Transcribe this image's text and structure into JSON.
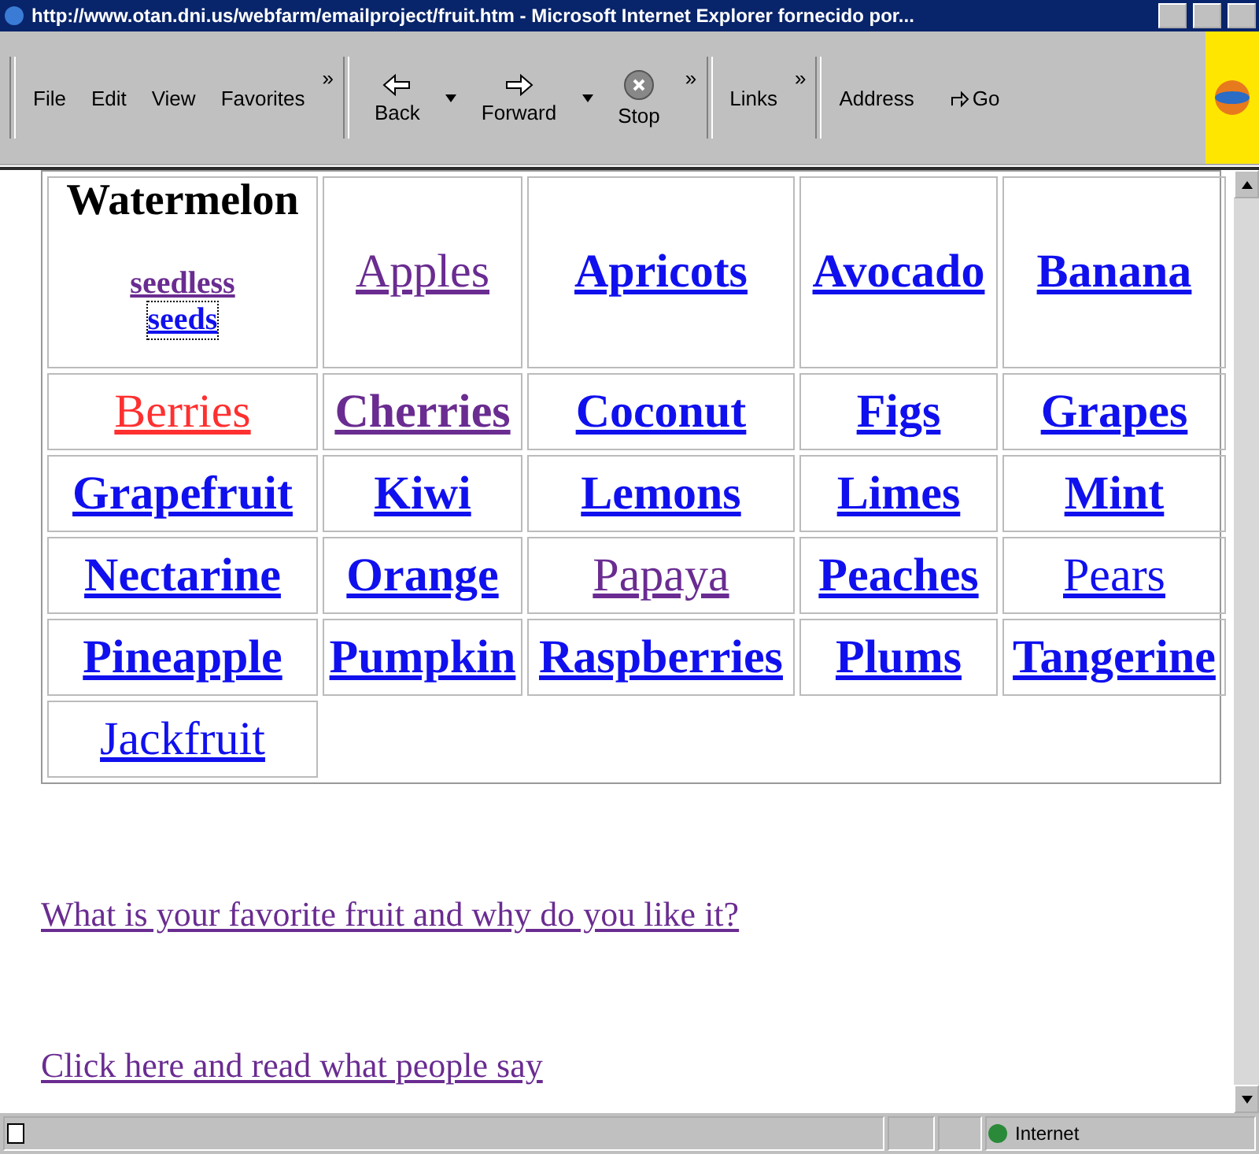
{
  "window": {
    "title": "http://www.otan.dni.us/webfarm/emailproject/fruit.htm - Microsoft Internet Explorer fornecido por..."
  },
  "menu": [
    "File",
    "Edit",
    "View",
    "Favorites"
  ],
  "toolbar": {
    "chevrons": [
      "»",
      "»",
      "»"
    ],
    "buttons": [
      {
        "kind": "back",
        "label": "Back"
      },
      {
        "kind": "forward",
        "label": "Forward"
      },
      {
        "kind": "stop",
        "label": "Stop"
      }
    ],
    "links": "Links",
    "address": "Address",
    "go": "Go"
  },
  "watermelon": {
    "title": "Watermelon",
    "links": [
      {
        "text": "seedless",
        "visited": true,
        "focused": false
      },
      {
        "text": "seeds",
        "visited": false,
        "focused": true
      }
    ]
  },
  "fruits": [
    {
      "text": "Apples",
      "visited": true,
      "active": false,
      "bold": false
    },
    {
      "text": "Apricots",
      "visited": false,
      "active": false,
      "bold": true
    },
    {
      "text": "Avocado",
      "visited": false,
      "active": false,
      "bold": true
    },
    {
      "text": "Banana",
      "visited": false,
      "active": false,
      "bold": true
    },
    {
      "text": "Berries",
      "visited": false,
      "active": true,
      "bold": false
    },
    {
      "text": "Cherries",
      "visited": true,
      "active": false,
      "bold": true
    },
    {
      "text": "Coconut",
      "visited": false,
      "active": false,
      "bold": true
    },
    {
      "text": "Figs",
      "visited": false,
      "active": false,
      "bold": true
    },
    {
      "text": "Grapes",
      "visited": false,
      "active": false,
      "bold": true
    },
    {
      "text": "Grapefruit",
      "visited": false,
      "active": false,
      "bold": true
    },
    {
      "text": "Kiwi",
      "visited": false,
      "active": false,
      "bold": true
    },
    {
      "text": "Lemons",
      "visited": false,
      "active": false,
      "bold": true
    },
    {
      "text": "Limes",
      "visited": false,
      "active": false,
      "bold": true
    },
    {
      "text": "Mint",
      "visited": false,
      "active": false,
      "bold": true
    },
    {
      "text": "Nectarine",
      "visited": false,
      "active": false,
      "bold": true
    },
    {
      "text": "Orange",
      "visited": false,
      "active": false,
      "bold": true
    },
    {
      "text": "Papaya",
      "visited": true,
      "active": false,
      "bold": false
    },
    {
      "text": "Peaches",
      "visited": false,
      "active": false,
      "bold": true
    },
    {
      "text": "Pears",
      "visited": false,
      "active": false,
      "bold": false
    },
    {
      "text": "Pineapple",
      "visited": false,
      "active": false,
      "bold": true
    },
    {
      "text": "Pumpkin",
      "visited": false,
      "active": false,
      "bold": true
    },
    {
      "text": "Raspberries",
      "visited": false,
      "active": false,
      "bold": true
    },
    {
      "text": "Plums",
      "visited": false,
      "active": false,
      "bold": true
    },
    {
      "text": "Tangerine",
      "visited": false,
      "active": false,
      "bold": true
    },
    {
      "text": "Jackfruit",
      "visited": false,
      "active": false,
      "bold": false
    }
  ],
  "page_links": [
    {
      "text": "What is your favorite fruit and why do you like it?",
      "visited": true
    },
    {
      "text": "Click here and read what people say",
      "visited": true
    }
  ],
  "status_bar": {
    "zone": "Internet"
  }
}
